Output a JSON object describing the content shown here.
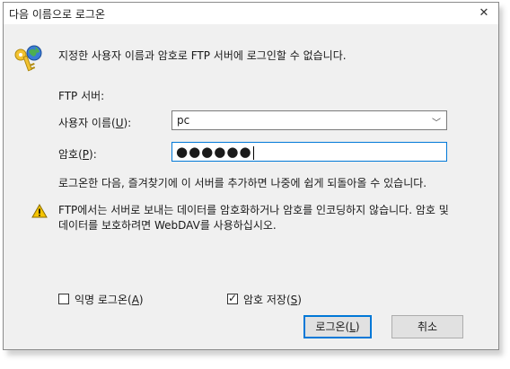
{
  "window": {
    "title": "다음 이름으로 로그온",
    "close_glyph": "✕"
  },
  "message": "지정한 사용자 이름과 암호로 FTP 서버에 로그인할 수 없습니다.",
  "ftp_server_label": "FTP 서버:",
  "username": {
    "label_pre": "사용자 이름(",
    "label_key": "U",
    "label_post": "):",
    "value": "pc"
  },
  "password": {
    "label_pre": "암호(",
    "label_key": "P",
    "label_post": "):",
    "masked_value": "●●●●●●"
  },
  "info_text": "로그온한 다음, 즐겨찾기에 이 서버를 추가하면 나중에 쉽게 되돌아올 수 있습니다.",
  "warning_line1": "FTP에서는 서버로 보내는 데이터를 암호화하거나 암호를 인코딩하지 않습니다. 암호 및",
  "warning_line2": "데이터를 보호하려면 WebDAV를 사용하십시오.",
  "anonymous_checkbox": {
    "label_pre": "익명 로그온(",
    "label_key": "A",
    "label_post": ")",
    "checked": false
  },
  "save_password_checkbox": {
    "label_pre": "암호 저장(",
    "label_key": "S",
    "label_post": ")",
    "checked": true
  },
  "login_button": {
    "label_pre": "로그온(",
    "label_key": "L",
    "label_post": ")"
  },
  "cancel_button": {
    "label": "취소"
  },
  "colors": {
    "accent": "#0078d7",
    "warning": "#f5c400"
  }
}
